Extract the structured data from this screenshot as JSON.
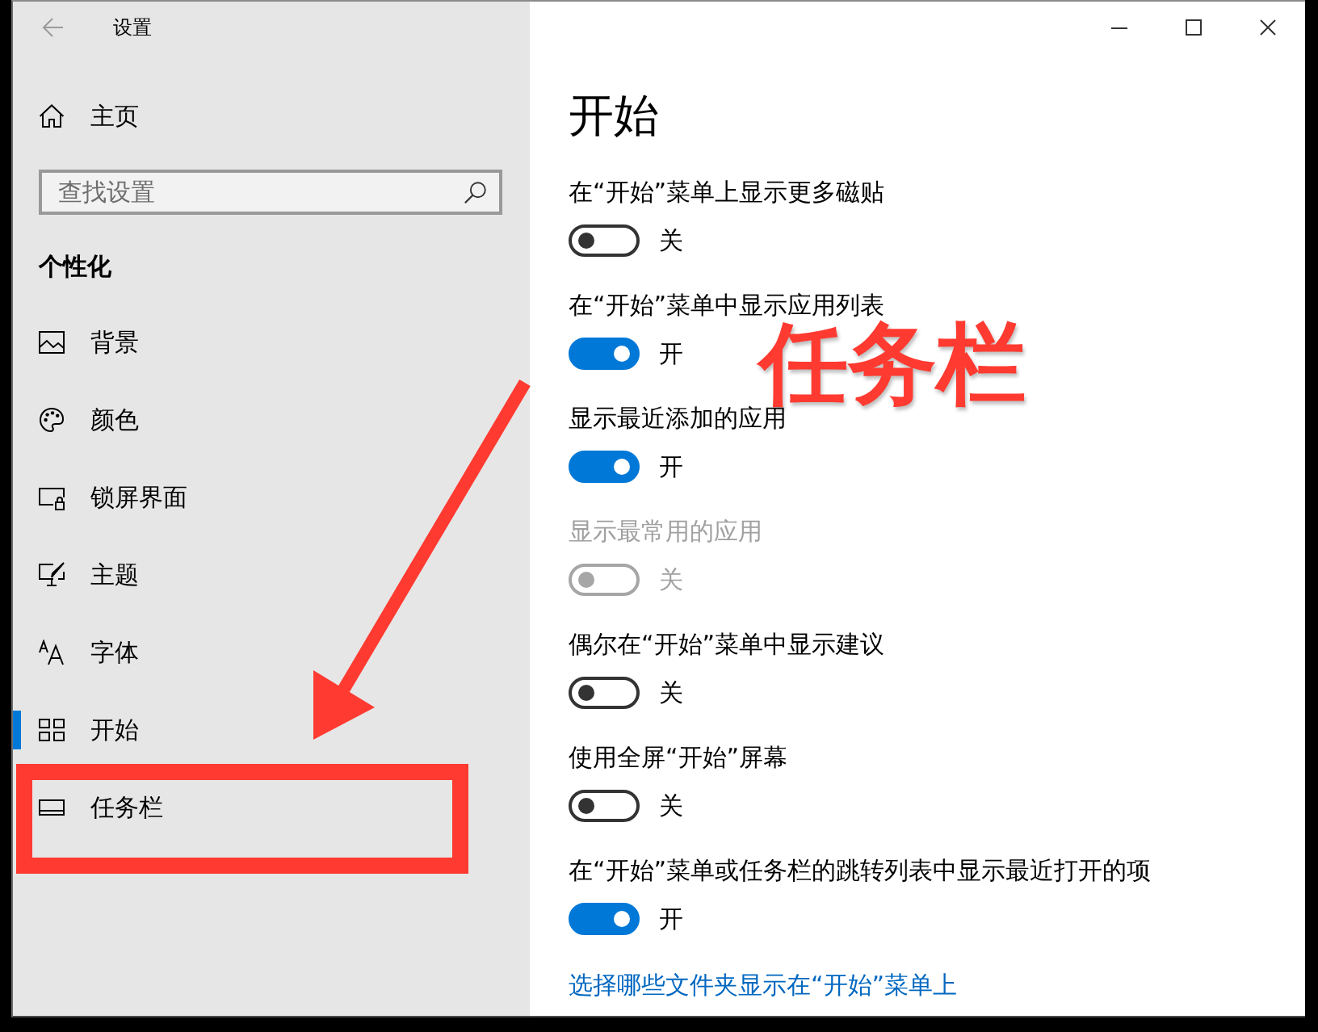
{
  "window": {
    "title": "设置"
  },
  "sidebar": {
    "home": "主页",
    "search": {
      "placeholder": "查找设置"
    },
    "section": "个性化",
    "items": [
      {
        "label": "背景",
        "selected": false,
        "highlighted": false
      },
      {
        "label": "颜色",
        "selected": false,
        "highlighted": false
      },
      {
        "label": "锁屏界面",
        "selected": false,
        "highlighted": false
      },
      {
        "label": "主题",
        "selected": false,
        "highlighted": false
      },
      {
        "label": "字体",
        "selected": false,
        "highlighted": false
      },
      {
        "label": "开始",
        "selected": true,
        "highlighted": false
      },
      {
        "label": "任务栏",
        "selected": false,
        "highlighted": true
      }
    ]
  },
  "main": {
    "heading": "开始",
    "settings": [
      {
        "label": "在“开始”菜单上显示更多磁贴",
        "on": false,
        "disabled": false,
        "state_text": "关"
      },
      {
        "label": "在“开始”菜单中显示应用列表",
        "on": true,
        "disabled": false,
        "state_text": "开"
      },
      {
        "label": "显示最近添加的应用",
        "on": true,
        "disabled": false,
        "state_text": "开"
      },
      {
        "label": "显示最常用的应用",
        "on": false,
        "disabled": true,
        "state_text": "关"
      },
      {
        "label": "偶尔在“开始”菜单中显示建议",
        "on": false,
        "disabled": false,
        "state_text": "关"
      },
      {
        "label": "使用全屏“开始”屏幕",
        "on": false,
        "disabled": false,
        "state_text": "关"
      },
      {
        "label": "在“开始”菜单或任务栏的跳转列表中显示最近打开的项",
        "on": true,
        "disabled": false,
        "state_text": "开"
      }
    ],
    "link": "选择哪些文件夹显示在“开始”菜单上"
  },
  "annotation": {
    "callout": "任务栏"
  }
}
